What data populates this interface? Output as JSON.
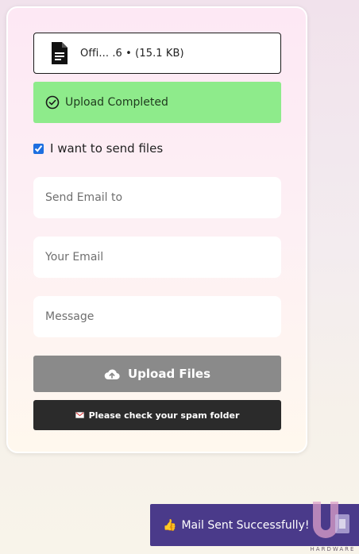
{
  "file": {
    "name": "Offi... .6 • (15.1 KB)",
    "icon": "document-icon"
  },
  "upload_status": {
    "text": "Upload Completed",
    "icon": "check-circle-icon",
    "color": "#8eeb8b"
  },
  "send_files": {
    "label": "I want to send files",
    "checked": true
  },
  "form": {
    "to_placeholder": "Send Email to",
    "from_placeholder": "Your Email",
    "message_placeholder": "Message"
  },
  "upload_button": {
    "label": "Upload Files",
    "icon": "cloud-upload-icon"
  },
  "spam_note": {
    "text": "Please check your spam folder",
    "icon": "mail-icon"
  },
  "toast": {
    "text": "Mail Sent Successfully!",
    "icon": "thumbs-up-icon",
    "color": "#4a3a8a"
  },
  "watermark": {
    "brand": "HARDWARE"
  }
}
